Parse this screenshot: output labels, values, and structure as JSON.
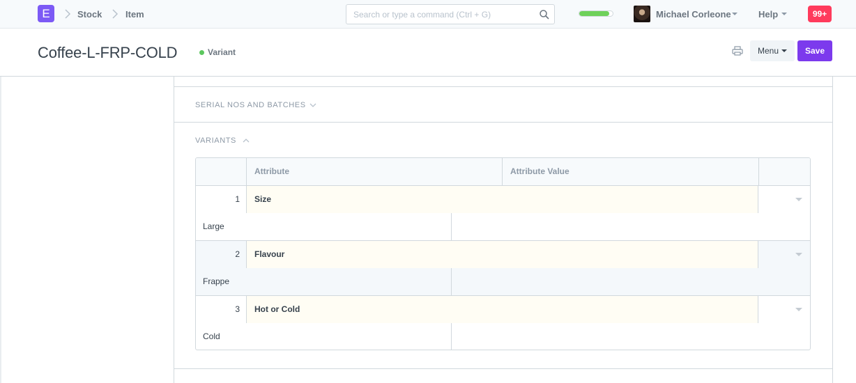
{
  "navbar": {
    "logo_letter": "E",
    "breadcrumbs": [
      "Stock",
      "Item"
    ],
    "search_placeholder": "Search or type a command (Ctrl + G)",
    "progress_fraction": 0.9,
    "user_name": "Michael Corleone",
    "help_label": "Help",
    "notification_count": "99+"
  },
  "page": {
    "title": "Coffee-L-FRP-COLD",
    "status": "Variant",
    "menu_label": "Menu",
    "save_label": "Save"
  },
  "sections": {
    "serial": "SERIAL NOS AND BATCHES",
    "variants": "VARIANTS"
  },
  "grid": {
    "headers": [
      "Attribute",
      "Attribute Value"
    ],
    "rows": [
      {
        "idx": "1",
        "attribute": "Size",
        "value": "Large"
      },
      {
        "idx": "2",
        "attribute": "Flavour",
        "value": "Frappe"
      },
      {
        "idx": "3",
        "attribute": "Hot or Cold",
        "value": "Cold"
      }
    ]
  },
  "colors": {
    "brand": "#7c5af5",
    "primary_button": "#7c3aed",
    "notification": "#ff3b5c",
    "status_green": "#5cc75e"
  }
}
